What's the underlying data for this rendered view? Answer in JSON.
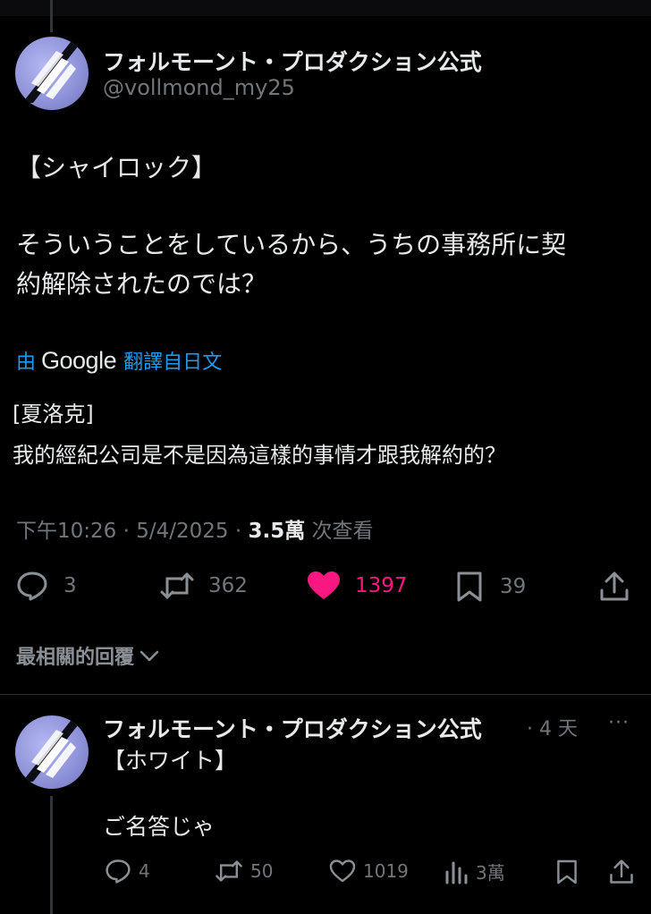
{
  "post": {
    "author_name": "フォルモーント・プロダクション公式",
    "author_handle": "@vollmond_my25",
    "text_line1": "【シャイロック】",
    "text_line2": "そういうことをしているから、うちの事務所に契",
    "text_line3": "約解除されたのでは？",
    "translate_prefix": "由",
    "translate_brand": "Google",
    "translate_suffix": "翻譯自日文",
    "translation_line1": "[夏洛克]",
    "translation_line2": "我的經紀公司是不是因為這樣的事情才跟我解約的？",
    "time": "下午10:26",
    "date": "5/4/2025",
    "sep": "·",
    "views_count": "3.5萬",
    "views_label": "次查看",
    "replies": "3",
    "reposts": "362",
    "likes": "1397",
    "bookmarks": "39",
    "like_color": "#f91880"
  },
  "replies_sort": {
    "label": "最相關的回覆"
  },
  "reply": {
    "author_name": "フォルモーント・プロダクション公式",
    "time": "· 4 天",
    "more": "···",
    "text_line1": "【ホワイト】",
    "text_line2": "ご名答じゃ",
    "replies": "4",
    "reposts": "50",
    "likes": "1019",
    "views": "3萬"
  }
}
